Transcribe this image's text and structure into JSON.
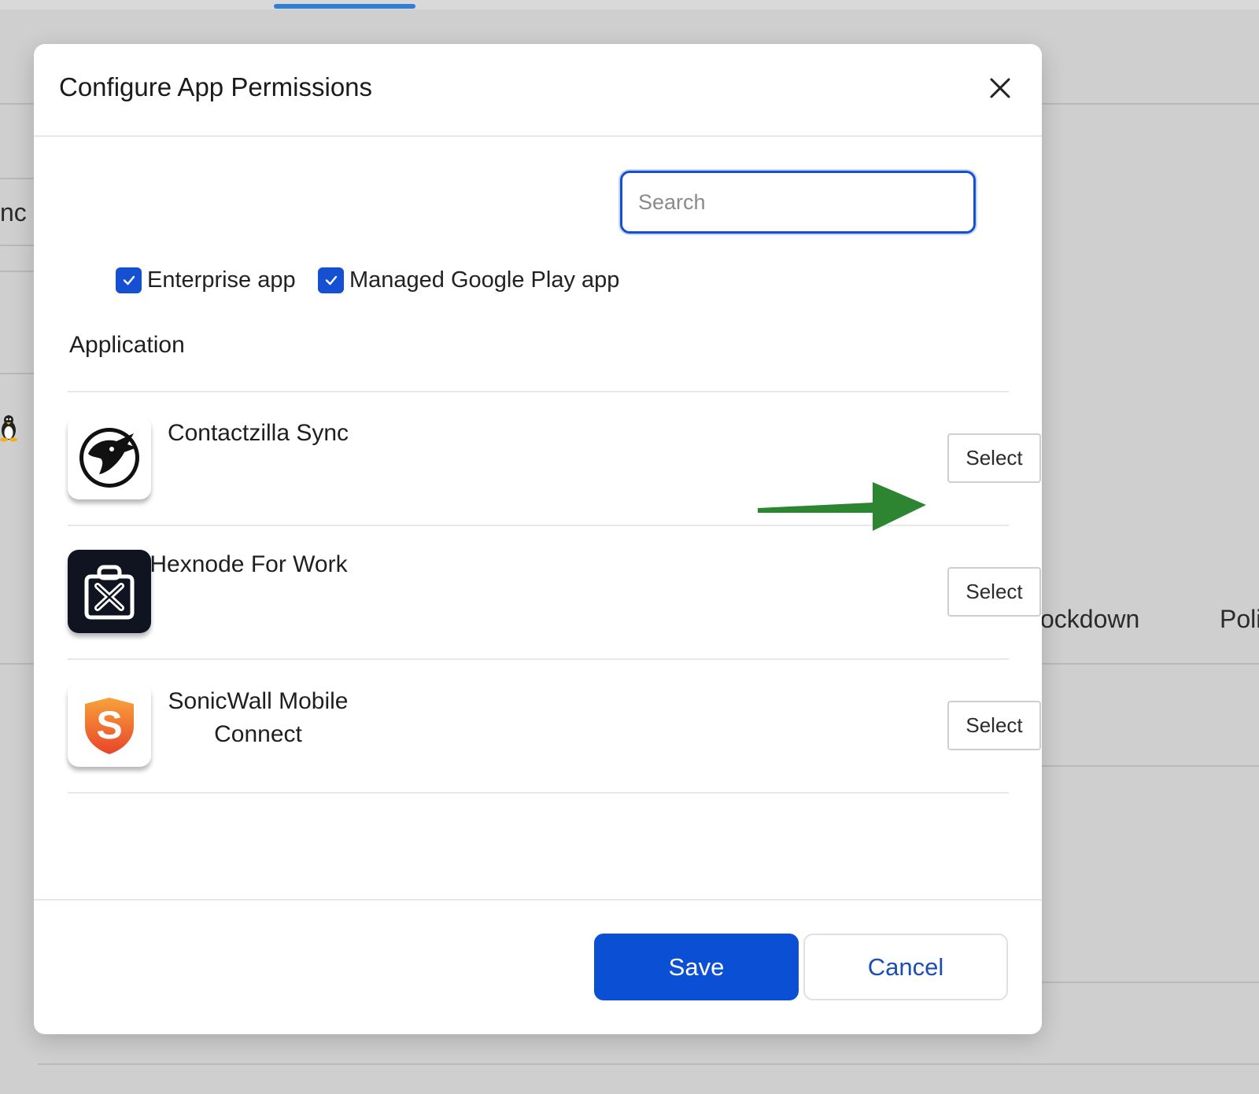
{
  "background": {
    "left_partial_text": "nc",
    "right_partial_text_1": "ockdown",
    "right_partial_text_2": "Poli"
  },
  "modal": {
    "title": "Configure App Permissions",
    "search": {
      "placeholder": "Search",
      "value": ""
    },
    "filters": [
      {
        "label": "Enterprise app",
        "checked": true
      },
      {
        "label": "Managed Google Play app",
        "checked": true
      }
    ],
    "section_heading": "Application",
    "apps": [
      {
        "name": "Contactzilla Sync",
        "icon": "contactzilla-app-icon",
        "action_label": "Select"
      },
      {
        "name": "Hexnode For Work",
        "icon": "hexnode-app-icon",
        "action_label": "Select"
      },
      {
        "name": "SonicWall Mobile Connect",
        "icon": "sonicwall-app-icon",
        "action_label": "Select"
      }
    ],
    "footer": {
      "save_label": "Save",
      "cancel_label": "Cancel"
    }
  },
  "colors": {
    "primary": "#0b4fd4",
    "checkbox": "#1550d2",
    "cancel_text": "#1b4fb5",
    "annotation_arrow": "#2e8531",
    "sonicwall_orange": "#f26b2a"
  }
}
